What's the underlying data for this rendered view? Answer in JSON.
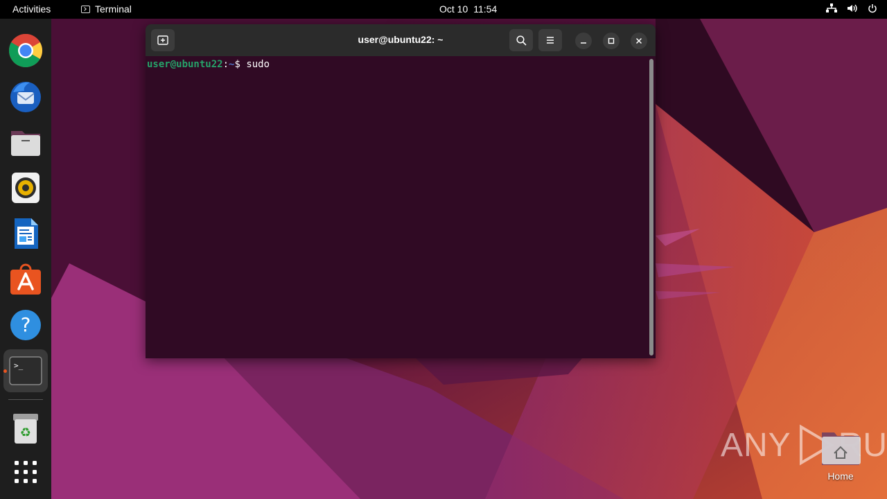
{
  "topbar": {
    "activities": "Activities",
    "app_name": "Terminal",
    "date": "Oct 10",
    "time": "11:54",
    "tray_icons": [
      "network-icon",
      "volume-icon",
      "power-icon"
    ]
  },
  "dock": {
    "items": [
      {
        "name": "chrome",
        "icon": "chrome-icon"
      },
      {
        "name": "thunderbird",
        "icon": "thunderbird-icon"
      },
      {
        "name": "files",
        "icon": "files-icon"
      },
      {
        "name": "rhythmbox",
        "icon": "rhythmbox-icon"
      },
      {
        "name": "libreoffice-writer",
        "icon": "writer-icon"
      },
      {
        "name": "app-center",
        "icon": "app-center-icon"
      },
      {
        "name": "help",
        "icon": "help-icon"
      },
      {
        "name": "terminal",
        "icon": "terminal-icon",
        "running": true
      },
      {
        "name": "trash",
        "icon": "trash-icon"
      },
      {
        "name": "show-apps",
        "icon": "app-grid-icon"
      }
    ],
    "accent": "#e95420"
  },
  "terminal": {
    "title": "user@ubuntu22: ~",
    "prompt_user": "user@ubuntu22",
    "prompt_sep": ":",
    "prompt_path": "~",
    "prompt_symbol": "$ ",
    "command": "sudo",
    "background": "#300a24"
  },
  "desktop": {
    "home_label": "Home"
  },
  "watermark": {
    "text_left": "ANY",
    "text_right": "RUN"
  }
}
